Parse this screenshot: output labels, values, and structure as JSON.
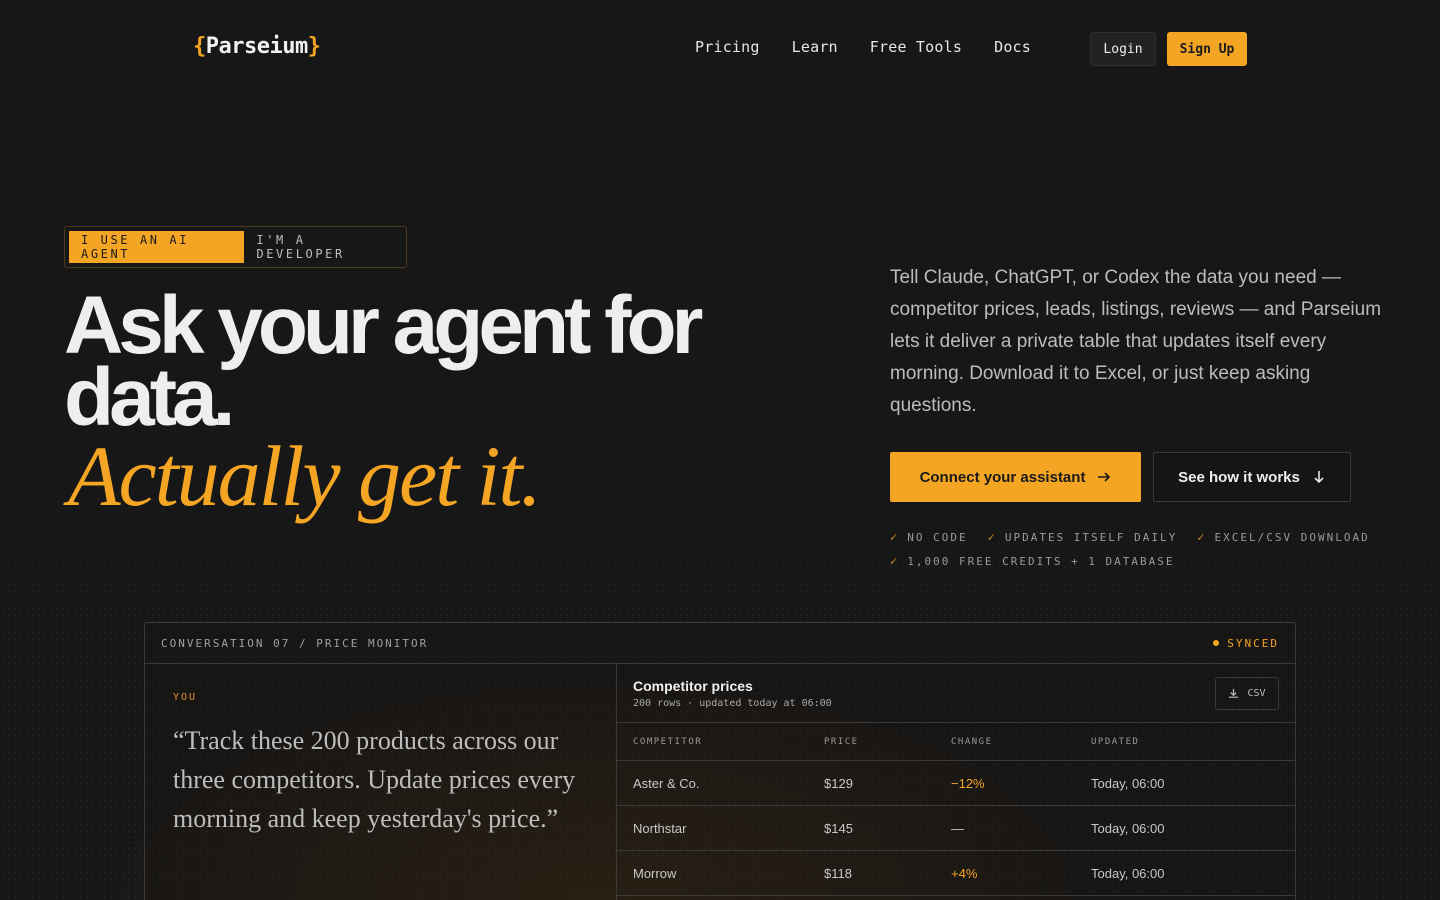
{
  "nav": {
    "logo_open": "{",
    "logo_name": "Parseium",
    "logo_close": "}",
    "links": [
      "Pricing",
      "Learn",
      "Free Tools",
      "Docs"
    ],
    "login": "Login",
    "signup": "Sign Up"
  },
  "hero": {
    "toggle_active": "I USE AN AI AGENT",
    "toggle_inactive": "I'M A DEVELOPER",
    "headline_line1": "Ask your agent for",
    "headline_line2": "data.",
    "headline_italic": "Actually get it.",
    "lede": "Tell Claude, ChatGPT, or Codex the data you need — competitor prices, leads, listings, reviews — and Parseium lets it deliver a private table that updates itself every morning. Download it to Excel, or just keep asking questions.",
    "cta_primary": "Connect your assistant",
    "cta_secondary": "See how it works",
    "features": [
      "NO CODE",
      "UPDATES ITSELF DAILY",
      "EXCEL/CSV DOWNLOAD",
      "1,000 FREE CREDITS + 1 DATABASE"
    ]
  },
  "panel": {
    "title": "CONVERSATION 07 / PRICE MONITOR",
    "status": "SYNCED",
    "you_label": "YOU",
    "quote": "“Track these 200 products across our three competitors. Update prices every morning and keep yesterday's price.”",
    "table_title": "Competitor prices",
    "table_sub": "200 rows · updated today at 06:00",
    "csv": "CSV",
    "columns": [
      "COMPETITOR",
      "PRICE",
      "CHANGE",
      "UPDATED"
    ],
    "rows": [
      {
        "competitor": "Aster & Co.",
        "price": "$129",
        "change": "−12%",
        "updated": "Today, 06:00"
      },
      {
        "competitor": "Northstar",
        "price": "$145",
        "change": "—",
        "updated": "Today, 06:00"
      },
      {
        "competitor": "Morrow",
        "price": "$118",
        "change": "+4%",
        "updated": "Today, 06:00"
      }
    ]
  },
  "colors": {
    "accent": "#f5a524",
    "background": "#171717"
  }
}
